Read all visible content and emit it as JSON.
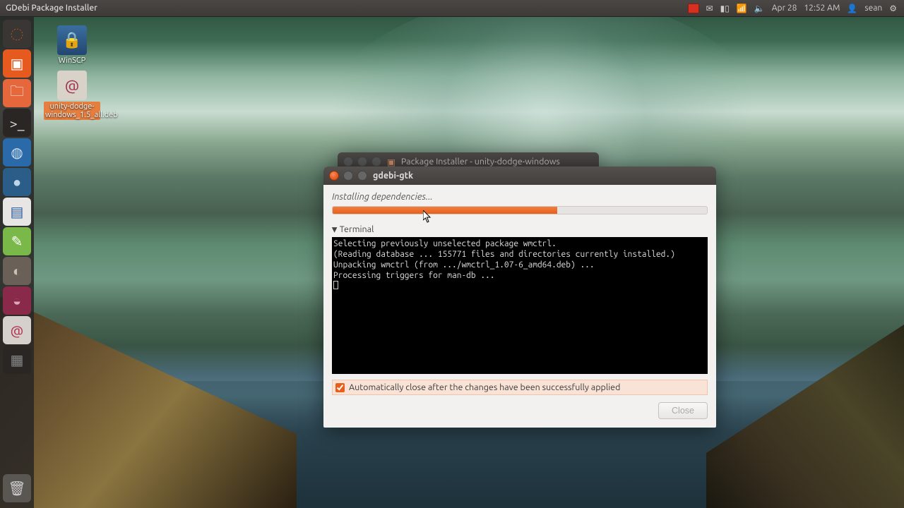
{
  "panel": {
    "app_title": "GDebi Package Installer",
    "date": "Apr 28",
    "time": "12:52 AM",
    "user": "sean"
  },
  "launcher": {
    "items": [
      {
        "name": "dash",
        "bg": "#3a3633",
        "glyph": "◌",
        "color": "#e85f1b"
      },
      {
        "name": "gdebi-active",
        "bg": "#e65a1f",
        "glyph": "▣",
        "color": "#fff"
      },
      {
        "name": "nautilus",
        "bg": "#e5673b",
        "glyph": "🗀",
        "color": "#fff"
      },
      {
        "name": "terminal",
        "bg": "#2a2624",
        "glyph": ">_",
        "color": "#ddd"
      },
      {
        "name": "chromium",
        "bg": "#2b6aa8",
        "glyph": "◍",
        "color": "#cfe0f0"
      },
      {
        "name": "browser",
        "bg": "#2a5e88",
        "glyph": "●",
        "color": "#bcd5e8"
      },
      {
        "name": "libreoffice",
        "bg": "#e8e6e4",
        "glyph": "▤",
        "color": "#2a5ea0"
      },
      {
        "name": "editor",
        "bg": "#7ab84a",
        "glyph": "✎",
        "color": "#fff"
      },
      {
        "name": "gimp",
        "bg": "#6a6058",
        "glyph": "◐",
        "color": "#cbbfae"
      },
      {
        "name": "software-center",
        "bg": "#8a2a4a",
        "glyph": "◒",
        "color": "#e0a6bc"
      },
      {
        "name": "debian",
        "bg": "#d5d0cb",
        "glyph": "@",
        "color": "#b03050"
      },
      {
        "name": "workspaces",
        "bg": "#2a2624",
        "glyph": "▦",
        "color": "#888"
      }
    ],
    "trash": {
      "glyph": "🗑"
    }
  },
  "desktop": {
    "winscp": {
      "label": "WinSCP"
    },
    "deb": {
      "label": "unity-dodge-windows_1.5_all.deb"
    }
  },
  "parent_window": {
    "title": "Package Installer - unity-dodge-windows"
  },
  "gdebi": {
    "title": "gdebi-gtk",
    "status": "Installing dependencies...",
    "progress_pct": 60,
    "terminal_label": "Terminal",
    "terminal_lines": "Selecting previously unselected package wmctrl.\n(Reading database ... 155771 files and directories currently installed.)\nUnpacking wmctrl (from .../wmctrl_1.07-6_amd64.deb) ...\nProcessing triggers for man-db ...",
    "auto_close_checked": true,
    "auto_close_label": "Automatically close after the changes have been successfully applied",
    "close_label": "Close",
    "close_enabled": false
  }
}
